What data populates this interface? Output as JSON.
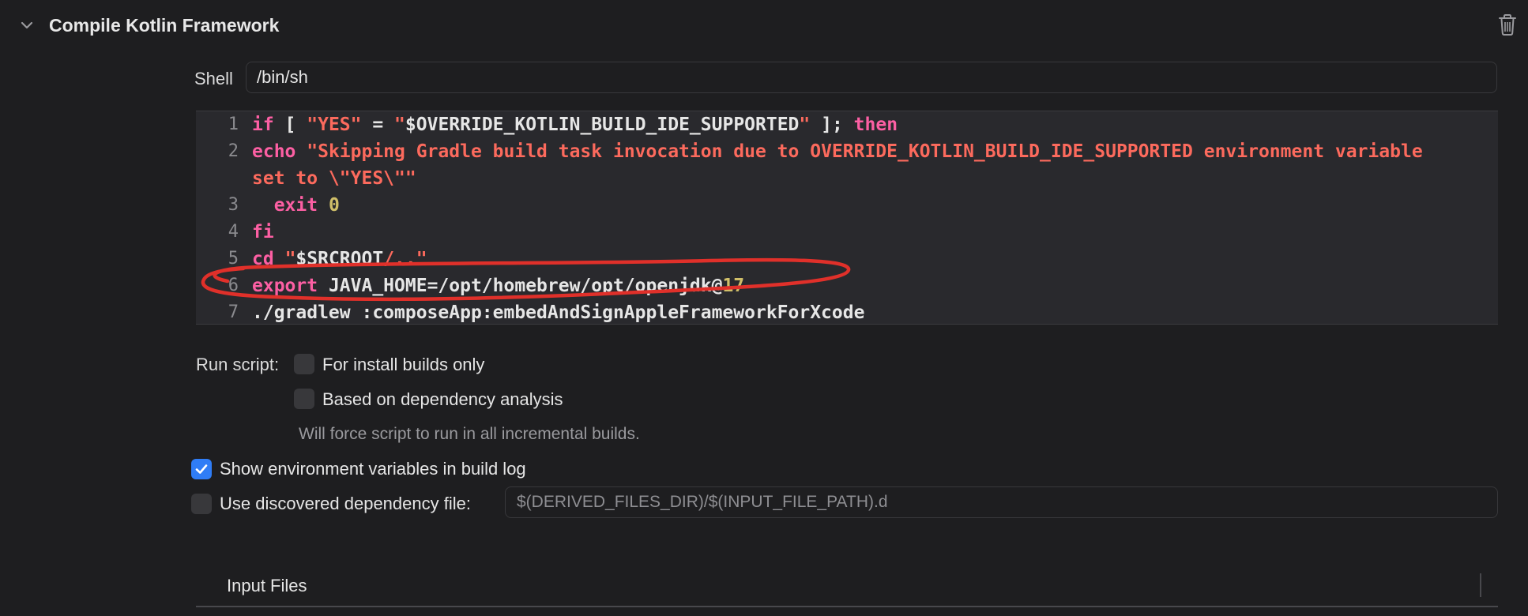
{
  "phase": {
    "title": "Compile Kotlin Framework",
    "disclosure_icon": "chevron-down-icon",
    "delete_icon": "trash-icon"
  },
  "shell": {
    "label": "Shell",
    "value": "/bin/sh"
  },
  "script": {
    "line_numbers": [
      "1",
      "2",
      "3",
      "4",
      "5",
      "6",
      "7"
    ],
    "lines": [
      [
        {
          "t": "kw",
          "v": "if"
        },
        {
          "t": "plain",
          "v": " [ "
        },
        {
          "t": "str",
          "v": "\"YES\""
        },
        {
          "t": "plain",
          "v": " = "
        },
        {
          "t": "str",
          "v": "\""
        },
        {
          "t": "plain",
          "v": "$OVERRIDE_KOTLIN_BUILD_IDE_SUPPORTED"
        },
        {
          "t": "str",
          "v": "\""
        },
        {
          "t": "plain",
          "v": " ]; "
        },
        {
          "t": "kw",
          "v": "then"
        }
      ],
      [
        {
          "t": "plain",
          "v": "  "
        },
        {
          "t": "kw",
          "v": "echo"
        },
        {
          "t": "plain",
          "v": " "
        },
        {
          "t": "str",
          "v": "\"Skipping Gradle build task invocation due to OVERRIDE_KOTLIN_BUILD_IDE_SUPPORTED environment variable set to \\\"YES\\\"\""
        }
      ],
      [
        {
          "t": "plain",
          "v": "  "
        },
        {
          "t": "kw",
          "v": "exit"
        },
        {
          "t": "plain",
          "v": " "
        },
        {
          "t": "num",
          "v": "0"
        }
      ],
      [
        {
          "t": "kw",
          "v": "fi"
        }
      ],
      [
        {
          "t": "kw",
          "v": "cd"
        },
        {
          "t": "plain",
          "v": " "
        },
        {
          "t": "str",
          "v": "\""
        },
        {
          "t": "plain",
          "v": "$SRCROOT"
        },
        {
          "t": "str",
          "v": "/..\""
        }
      ],
      [
        {
          "t": "kw",
          "v": "export"
        },
        {
          "t": "plain",
          "v": " JAVA_HOME=/opt/homebrew/opt/openjdk@"
        },
        {
          "t": "num",
          "v": "17"
        }
      ],
      [
        {
          "t": "plain",
          "v": "./gradlew :composeApp:embedAndSignAppleFrameworkForXcode"
        }
      ]
    ],
    "annotation_color": "#e0302a",
    "annotated_line": "6"
  },
  "run_script": {
    "label": "Run script:",
    "install_builds_only": {
      "label": "For install builds only",
      "checked": false
    },
    "dependency_analysis": {
      "label": "Based on dependency analysis",
      "checked": false
    },
    "hint": "Will force script to run in all incremental builds."
  },
  "show_env_vars": {
    "label": "Show environment variables in build log",
    "checked": true
  },
  "dependency_file": {
    "label": "Use discovered dependency file:",
    "checked": false,
    "placeholder": "$(DERIVED_FILES_DIR)/$(INPUT_FILE_PATH).d"
  },
  "input_files": {
    "title": "Input Files"
  },
  "colors": {
    "background": "#1e1e20",
    "editor_bg": "#29292d",
    "keyword": "#fc5fa3",
    "string": "#fc6a5d",
    "number": "#d0bf69",
    "accent": "#2f7df6"
  }
}
